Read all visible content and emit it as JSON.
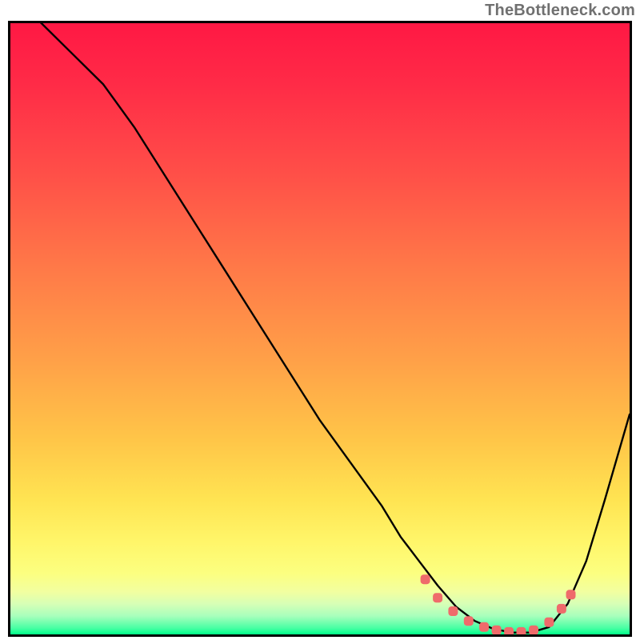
{
  "watermark": "TheBottleneck.com",
  "chart_data": {
    "type": "line",
    "title": "",
    "xlabel": "",
    "ylabel": "",
    "xlim": [
      0,
      100
    ],
    "ylim": [
      0,
      100
    ],
    "grid": false,
    "legend": false,
    "background_gradient": {
      "stops": [
        {
          "pos": 0,
          "color": "#ff1844"
        },
        {
          "pos": 25,
          "color": "#ff5048"
        },
        {
          "pos": 55,
          "color": "#ffa048"
        },
        {
          "pos": 78,
          "color": "#ffe452"
        },
        {
          "pos": 90,
          "color": "#f2ffa0"
        },
        {
          "pos": 97,
          "color": "#a8ffbc"
        },
        {
          "pos": 100,
          "color": "#00ff88"
        }
      ]
    },
    "series": [
      {
        "name": "bottleneck-curve",
        "color": "#000000",
        "x": [
          0,
          3,
          6,
          10,
          15,
          20,
          25,
          30,
          35,
          40,
          45,
          50,
          55,
          60,
          63,
          66,
          69,
          72,
          75,
          78,
          81,
          84,
          87,
          90,
          93,
          96,
          100
        ],
        "y": [
          105,
          102,
          99,
          95,
          90,
          83,
          75,
          67,
          59,
          51,
          43,
          35,
          28,
          21,
          16,
          12,
          8,
          4.5,
          2.2,
          0.9,
          0.3,
          0.3,
          1.2,
          5,
          12,
          22,
          36
        ]
      }
    ],
    "markers": {
      "name": "highlight-points",
      "color": "#ef6b6b",
      "style": "rounded-rect",
      "x": [
        67,
        69,
        71.5,
        74,
        76.5,
        78.5,
        80.5,
        82.5,
        84.5,
        87,
        89,
        90.5
      ],
      "y": [
        9,
        6,
        3.8,
        2.2,
        1.2,
        0.7,
        0.4,
        0.4,
        0.7,
        2,
        4.2,
        6.5
      ]
    }
  }
}
